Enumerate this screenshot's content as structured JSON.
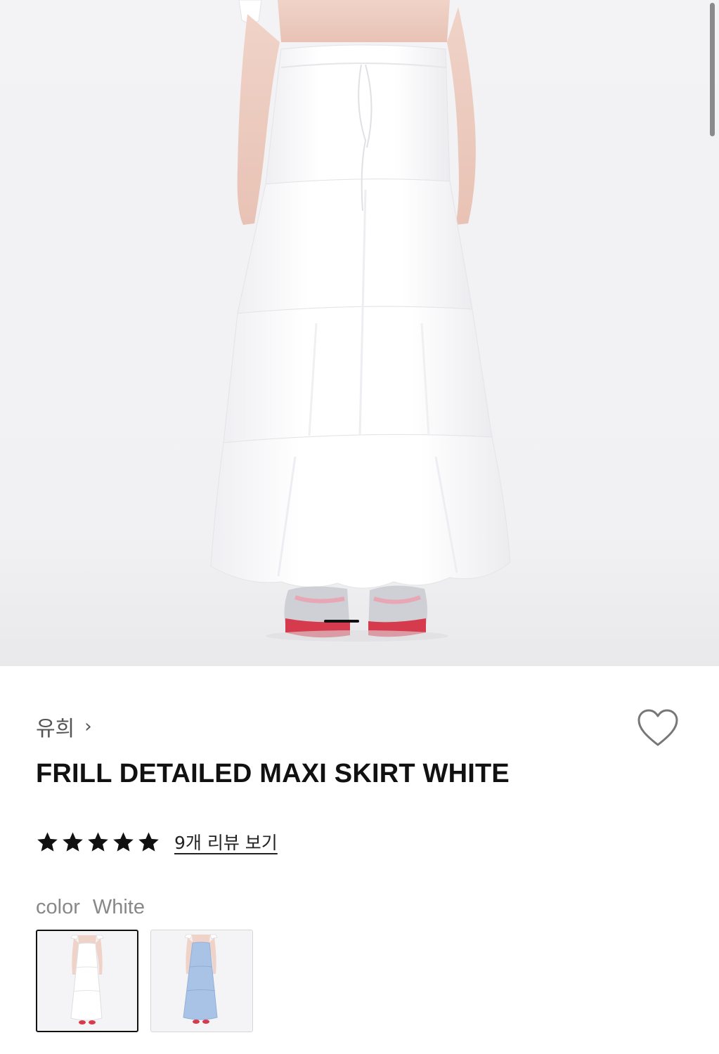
{
  "product": {
    "brand": "유희",
    "title": "FRILL DETAILED MAXI SKIRT WHITE",
    "rating_stars": 5,
    "reviews_link": "9개 리뷰 보기",
    "color_label": "color",
    "color_value": "White"
  },
  "gallery": {
    "active_index": 0
  },
  "icons": {
    "wishlist": "heart-outline-icon",
    "brand_chevron": "chevron-right-icon",
    "star": "star-filled-icon"
  },
  "colors": {
    "text_primary": "#111111",
    "text_muted": "#888888",
    "skirt_white": "#ffffff",
    "skirt_blue": "#a9c3e6",
    "sneaker_red": "#d63a4d"
  }
}
